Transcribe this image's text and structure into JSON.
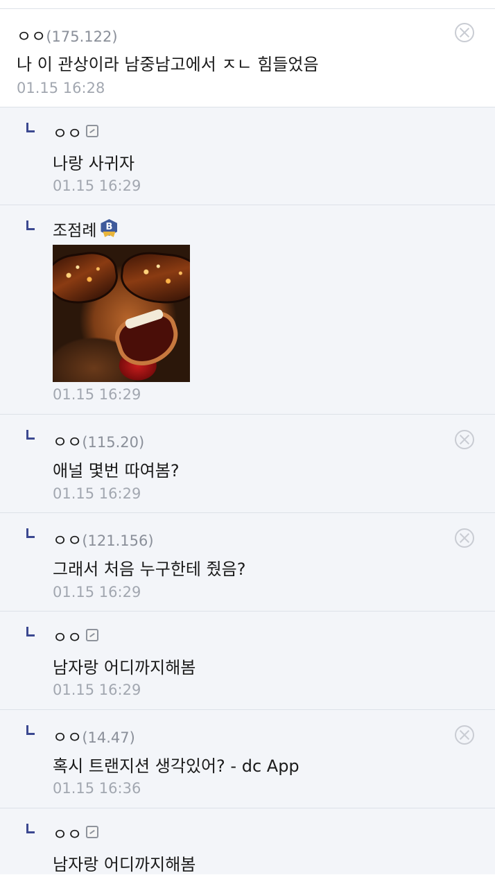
{
  "comments": [
    {
      "nick": "ㅇㅇ",
      "ip": "(175.122)",
      "text": "나 이 관상이라 남중남고에서 ㅈㄴ 힘들었음",
      "time": "01.15 16:28"
    },
    {
      "nick": "ㅇㅇ",
      "ip": "",
      "text": "나랑 사귀자",
      "time": "01.15 16:29"
    },
    {
      "nick": "조점례",
      "ip": "",
      "text": "",
      "time": "01.15 16:29",
      "badge": "B"
    },
    {
      "nick": "ㅇㅇ",
      "ip": "(115.20)",
      "text": "애널 몇번 따여봄?",
      "time": "01.15 16:29"
    },
    {
      "nick": "ㅇㅇ",
      "ip": "(121.156)",
      "text": "그래서 처음 누구한테 줬음?",
      "time": "01.15 16:29"
    },
    {
      "nick": "ㅇㅇ",
      "ip": "",
      "text": "남자랑 어디까지해봄",
      "time": "01.15 16:29"
    },
    {
      "nick": "ㅇㅇ",
      "ip": "(14.47)",
      "text": "혹시 트랜지션 생각있어? - dc App",
      "time": "01.15 16:36"
    },
    {
      "nick": "ㅇㅇ",
      "ip": "",
      "text": "남자랑 어디까지해봄",
      "time": ""
    }
  ],
  "colors": {
    "reply_bg": "#f3f5f9",
    "reply_mark": "#3b4890",
    "time": "#a2a7b0"
  }
}
